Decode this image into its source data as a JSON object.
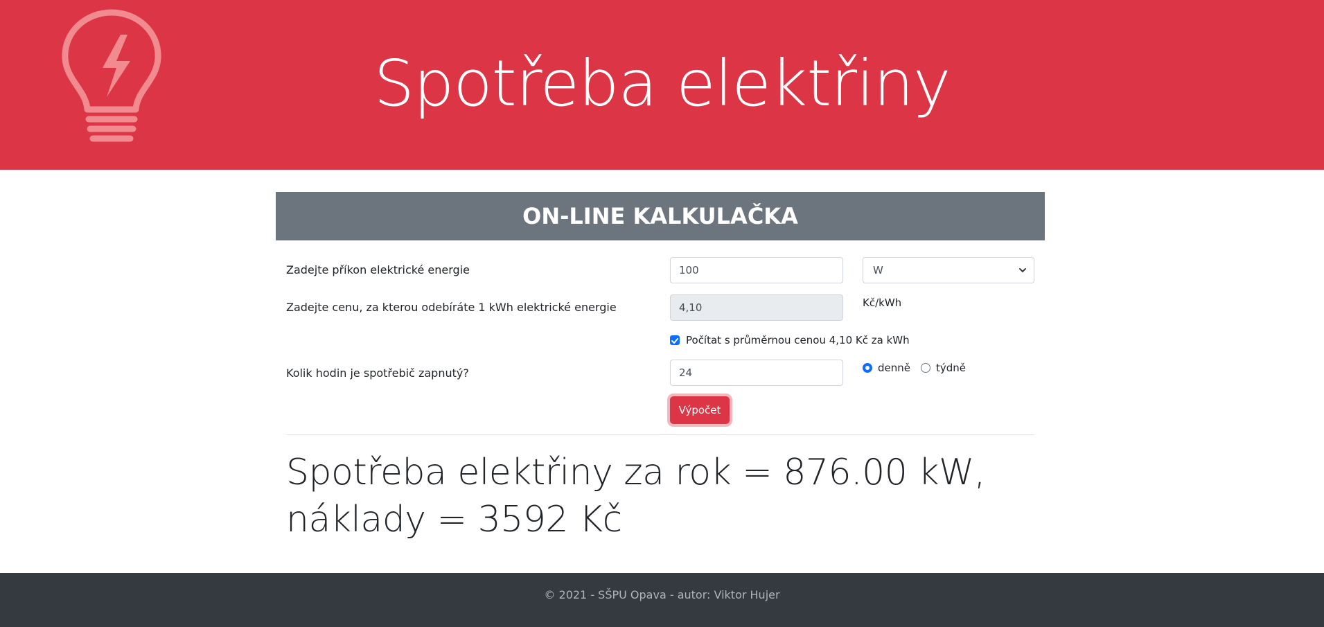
{
  "header": {
    "title": "Spotřeba elektřiny",
    "logo_icon": "lightbulb-lightning-icon",
    "background_color": "#dc3545"
  },
  "card": {
    "title": "ON-LINE KALKULAČKA"
  },
  "form": {
    "power_label": "Zadejte příkon elektrické energie",
    "power_value": "100",
    "power_unit": "W",
    "price_label": "Zadejte cenu, za kterou odebíráte 1 kWh elektrické energie",
    "price_value": "4,10",
    "price_unit": "Kč/kWh",
    "average_checkbox_label": "Počítat s průměrnou cenou 4,10 Kč za kWh",
    "average_checked": true,
    "hours_label": "Kolik hodin je spotřebič zapnutý?",
    "hours_value": "24",
    "period_options": [
      {
        "label": "denně",
        "selected": true
      },
      {
        "label": "týdně",
        "selected": false
      }
    ],
    "submit_label": "Výpočet"
  },
  "result": {
    "line1": "Spotřeba elektřiny za rok = 876.00 kW,",
    "line2": "náklady = 3592 Kč"
  },
  "footer": {
    "text": "© 2021 - SŠPU Opava - autor: Viktor Hujer"
  }
}
